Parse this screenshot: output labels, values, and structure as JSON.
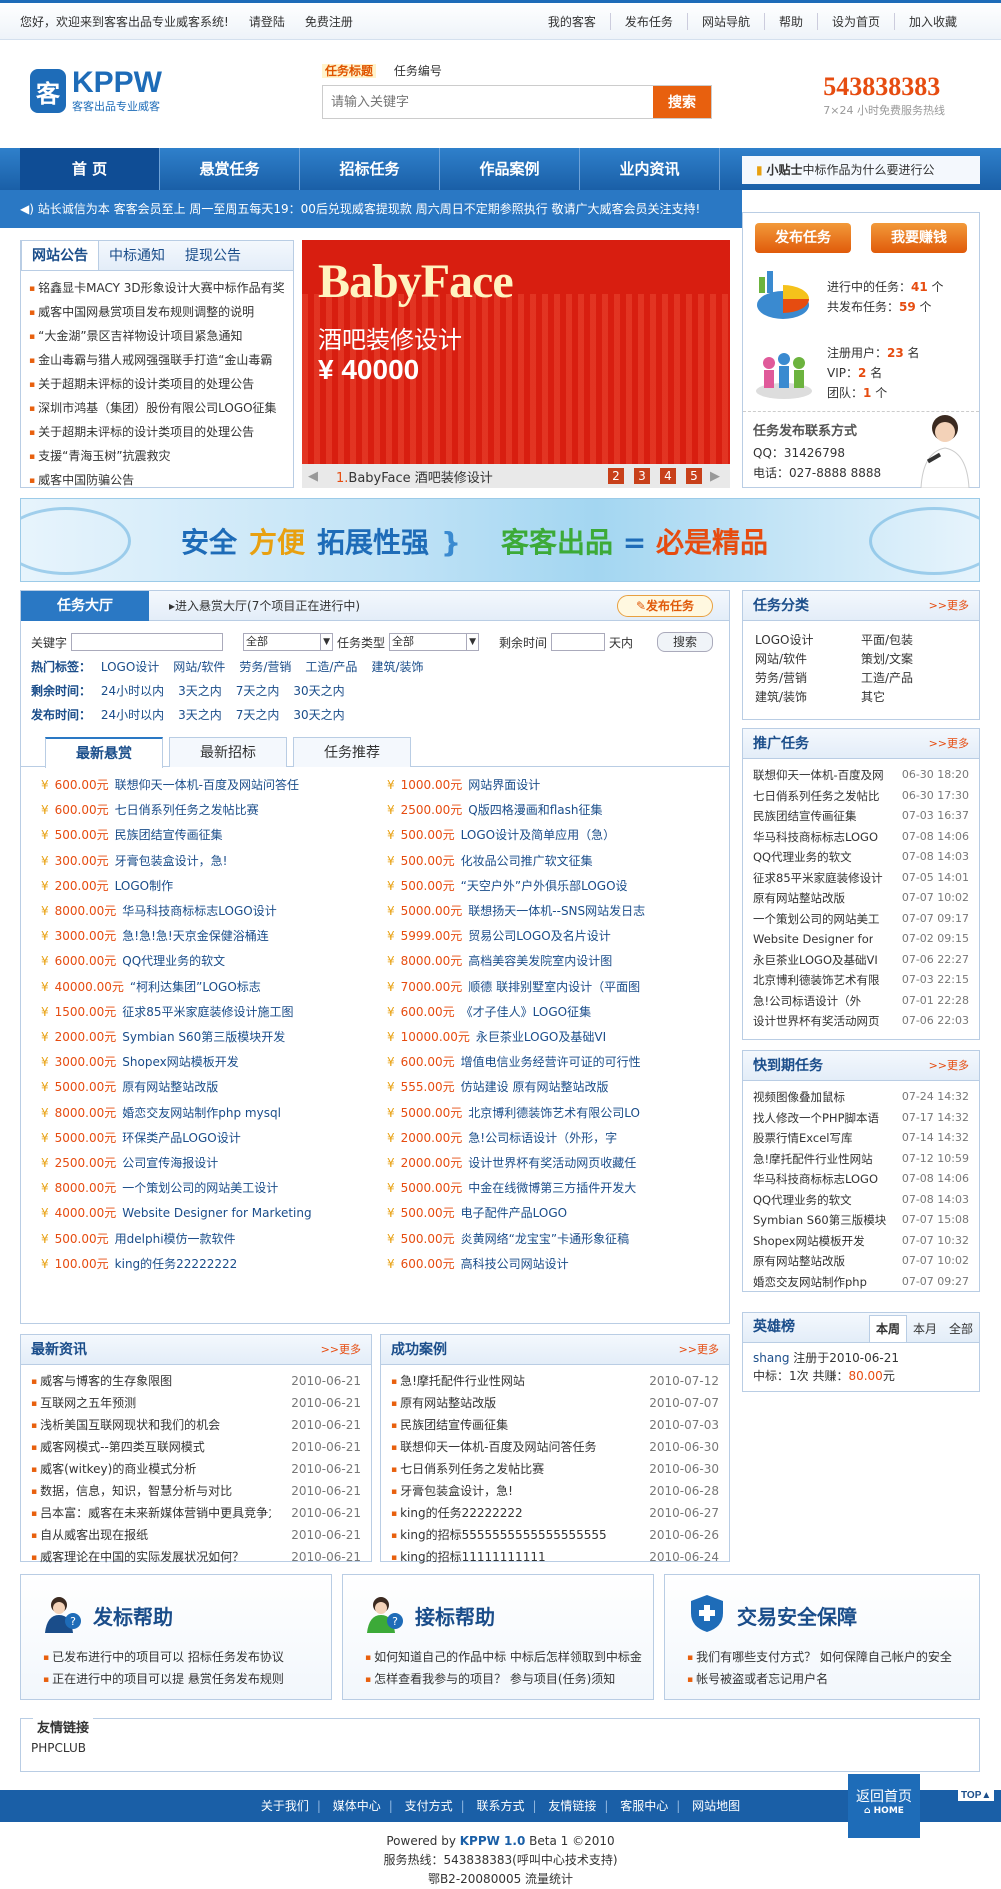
{
  "topbar": {
    "welcome": "您好，欢迎来到客客出品专业威客系统!",
    "login": "请登陆",
    "register": "免费注册",
    "links": [
      "我的客客",
      "发布任务",
      "网站导航",
      "帮助",
      "设为首页",
      "加入收藏"
    ]
  },
  "header": {
    "logo_text": "KPPW",
    "logo_sub": "客客出品专业威客",
    "search_tabs": [
      "任务标题",
      "任务编号"
    ],
    "search_placeholder": "请输入关键字",
    "search_button": "搜索",
    "hotline": "543838383",
    "hotline_note": "7×24 小时免费服务热线"
  },
  "nav": {
    "items": [
      "首  页",
      "悬赏任务",
      "招标任务",
      "作品案例",
      "业内资讯"
    ],
    "tip_label": "小贴士",
    "tip_text": "中标作品为什么要进行公"
  },
  "notice": "站长诚信为本  客客会员至上  周一至周五每天19：00后兑现威客提现款  周六周日不定期参照执行  敬请广大威客会员关注支持!",
  "announcements": {
    "tabs": [
      "网站公告",
      "中标通知",
      "提现公告"
    ],
    "items": [
      "铭鑫显卡MACY 3D形象设计大赛中标作品有奖",
      "威客中国网悬赏项目发布规则调整的说明",
      "“大金湖”景区吉祥物设计项目紧急通知",
      "金山毒霸与猎人戒网强强联手打造“金山毒霸",
      "关于超期未评标的设计类项目的处理公告",
      "深圳市鸿基（集团）股份有限公司LOGO征集",
      "关于超期未评标的设计类项目的处理公告",
      "支援“青海玉树”抗震救灾",
      "威客中国防骗公告"
    ]
  },
  "banner": {
    "title": "BabyFace",
    "subtitle": "酒吧装修设计",
    "price": "¥ 40000",
    "caption_index": "1.",
    "caption": "BabyFace 酒吧装修设计",
    "pages": [
      "2",
      "3",
      "4",
      "5"
    ]
  },
  "side_actions": {
    "publish_button": "发布任务",
    "earn_button": "我要赚钱",
    "ongoing_label": "进行中的任务：",
    "ongoing_value": "41",
    "total_label": "共发布任务：",
    "total_value": "59",
    "unit_tasks": "个",
    "users_label": "注册用户：",
    "users_value": "23",
    "unit_users": "名",
    "vip_label": "VIP：",
    "vip_value": "2",
    "team_label": "团队：",
    "team_value": "1",
    "contact_title": "任务发布联系方式",
    "qq": "QQ：31426798",
    "phone": "电话：027-8888 8888"
  },
  "slogan": {
    "parts": [
      "安全",
      "方便",
      "拓展性强"
    ],
    "brace": "}",
    "brand": "客客出品",
    "equals": "=",
    "result": "必是精品"
  },
  "hall": {
    "tab": "任务大厅",
    "subtitle": "进入悬赏大厅(7个项目正在进行中)",
    "publish": "发布任务",
    "keyword_label": "关键字",
    "select_all": "全部",
    "type_label": "任务类型",
    "type_value": "全部",
    "remain_label": "剩余时间",
    "days_label": "天内",
    "search_button": "搜索",
    "hot_label": "热门标签：",
    "hot_tags": [
      "LOGO设计",
      "网站/软件",
      "劳务/营销",
      "工造/产品",
      "建筑/装饰"
    ],
    "remain_label2": "剩余时间：",
    "remain_opts": [
      "24小时以内",
      "3天之内",
      "7天之内",
      "30天之内"
    ],
    "publish_label": "发布时间：",
    "publish_opts": [
      "24小时以内",
      "3天之内",
      "7天之内",
      "30天之内"
    ],
    "task_tabs": [
      "最新悬赏",
      "最新招标",
      "任务推荐"
    ],
    "currency": "¥",
    "unit": "元",
    "tasks": [
      {
        "amount": "600.00",
        "title": "联想仰天一体机-百度及网站问答任"
      },
      {
        "amount": "1000.00",
        "title": "网站界面设计"
      },
      {
        "amount": "600.00",
        "title": "七日俏系列任务之发帖比赛"
      },
      {
        "amount": "2500.00",
        "title": "Q版四格漫画和flash征集"
      },
      {
        "amount": "500.00",
        "title": "民族团结宣传画征集"
      },
      {
        "amount": "500.00",
        "title": "LOGO设计及简单应用（急）"
      },
      {
        "amount": "300.00",
        "title": "牙膏包装盒设计，急!"
      },
      {
        "amount": "500.00",
        "title": "化妆品公司推广软文征集"
      },
      {
        "amount": "200.00",
        "title": "LOGO制作"
      },
      {
        "amount": "500.00",
        "title": "“天空户外”户外俱乐部LOGO设"
      },
      {
        "amount": "8000.00",
        "title": "华马科技商标标志LOGO设计"
      },
      {
        "amount": "5000.00",
        "title": "联想扬天一体机--SNS网站发日志"
      },
      {
        "amount": "3000.00",
        "title": "急!急!急!天京金保健浴桶连"
      },
      {
        "amount": "5999.00",
        "title": "贸易公司LOGO及名片设计"
      },
      {
        "amount": "6000.00",
        "title": "QQ代理业务的软文"
      },
      {
        "amount": "8000.00",
        "title": "高档美容美发院室内设计图"
      },
      {
        "amount": "40000.00",
        "title": "“柯利达集团”LOGO标志"
      },
      {
        "amount": "7000.00",
        "title": "顺德 联排别墅室内设计（平面图"
      },
      {
        "amount": "1500.00",
        "title": "征求85平米家庭装修设计施工图"
      },
      {
        "amount": "600.00",
        "title": "《才子佳人》LOGO征集"
      },
      {
        "amount": "2000.00",
        "title": "Symbian S60第三版模块开发"
      },
      {
        "amount": "10000.00",
        "title": "永巨茶业LOGO及基础VI"
      },
      {
        "amount": "3000.00",
        "title": "Shopex网站模板开发"
      },
      {
        "amount": "600.00",
        "title": "增值电信业务经营许可证的可行性"
      },
      {
        "amount": "5000.00",
        "title": "原有网站整站改版"
      },
      {
        "amount": "555.00",
        "title": "仿站建设 原有网站整站改版"
      },
      {
        "amount": "8000.00",
        "title": "婚恋交友网站制作php mysql"
      },
      {
        "amount": "5000.00",
        "title": "北京博利德装饰艺术有限公司LO"
      },
      {
        "amount": "5000.00",
        "title": "环保类产品LOGO设计"
      },
      {
        "amount": "2000.00",
        "title": "急!公司标语设计（外形，字"
      },
      {
        "amount": "2500.00",
        "title": "公司宣传海报设计"
      },
      {
        "amount": "2000.00",
        "title": "设计世界杯有奖活动网页收藏任"
      },
      {
        "amount": "8000.00",
        "title": "一个策划公司的网站美工设计"
      },
      {
        "amount": "5000.00",
        "title": "中金在线微博第三方插件开发大"
      },
      {
        "amount": "4000.00",
        "title": "Website Designer for Marketing"
      },
      {
        "amount": "500.00",
        "title": "电子配件产品LOGO"
      },
      {
        "amount": "500.00",
        "title": "用delphi模仿一款软件"
      },
      {
        "amount": "500.00",
        "title": "炎黄网络“龙宝宝”卡通形象征稿"
      },
      {
        "amount": "100.00",
        "title": "king的任务22222222"
      },
      {
        "amount": "600.00",
        "title": "高科技公司网站设计"
      }
    ]
  },
  "categories": {
    "title": "任务分类",
    "more": ">>更多",
    "items": [
      "LOGO设计",
      "平面/包装",
      "网站/软件",
      "策划/文案",
      "劳务/营销",
      "工造/产品",
      "建筑/装饰",
      "其它"
    ]
  },
  "promo": {
    "title": "推广任务",
    "more": ">>更多",
    "items": [
      {
        "name": "联想仰天一体机-百度及网",
        "date": "06-30 18:20"
      },
      {
        "name": "七日俏系列任务之发帖比",
        "date": "06-30 17:30"
      },
      {
        "name": "民族团结宣传画征集",
        "date": "07-03 16:37"
      },
      {
        "name": "华马科技商标标志LOGO",
        "date": "07-08 14:06"
      },
      {
        "name": "QQ代理业务的软文",
        "date": "07-08 14:03"
      },
      {
        "name": "征求85平米家庭装修设计",
        "date": "07-05 14:01"
      },
      {
        "name": "原有网站整站改版",
        "date": "07-07 10:02"
      },
      {
        "name": "一个策划公司的网站美工",
        "date": "07-07 09:17"
      },
      {
        "name": "Website Designer for",
        "date": "07-02 09:15"
      },
      {
        "name": "永巨茶业LOGO及基础VI",
        "date": "07-06 22:27"
      },
      {
        "name": "北京博利德装饰艺术有限",
        "date": "07-03 22:15"
      },
      {
        "name": "急!公司标语设计（外",
        "date": "07-01 22:28"
      },
      {
        "name": "设计世界杯有奖活动网页",
        "date": "07-06 22:03"
      }
    ]
  },
  "soon": {
    "title": "快到期任务",
    "more": ">>更多",
    "items": [
      {
        "name": "视频图像叠加鼠标",
        "date": "07-24 14:32"
      },
      {
        "name": "找人修改一个PHP脚本语",
        "date": "07-17 14:32"
      },
      {
        "name": "股票行情Excel写库",
        "date": "07-14 14:32"
      },
      {
        "name": "急!摩托配件行业性网站",
        "date": "07-12 10:59"
      },
      {
        "name": "华马科技商标标志LOGO",
        "date": "07-08 14:06"
      },
      {
        "name": "QQ代理业务的软文",
        "date": "07-08 14:03"
      },
      {
        "name": "Symbian S60第三版模块",
        "date": "07-07 15:08"
      },
      {
        "name": "Shopex网站模板开发",
        "date": "07-07 10:32"
      },
      {
        "name": "原有网站整站改版",
        "date": "07-07 10:02"
      },
      {
        "name": "婚恋交友网站制作php",
        "date": "07-07 09:27"
      }
    ]
  },
  "hero": {
    "title": "英雄榜",
    "tabs": [
      "本周",
      "本月",
      "全部"
    ],
    "user": "shang",
    "reg_text": "注册于2010-06-21",
    "stats_label": "中标：1次  共赚：",
    "earned": "80.00",
    "earned_unit": "元"
  },
  "news": {
    "title": "最新资讯",
    "more": ">>更多",
    "items": [
      {
        "name": "威客与博客的生存象限图",
        "date": "2010-06-21"
      },
      {
        "name": "互联网之五年预测",
        "date": "2010-06-21"
      },
      {
        "name": "浅析美国互联网现状和我们的机会",
        "date": "2010-06-21"
      },
      {
        "name": "威客网模式--第四类互联网模式",
        "date": "2010-06-21"
      },
      {
        "name": "威客(witkey)的商业模式分析",
        "date": "2010-06-21"
      },
      {
        "name": "数据，信息，知识，智慧分析与对比",
        "date": "2010-06-21"
      },
      {
        "name": "吕本富：威客在未来新媒体营销中更具竞争力",
        "date": "2010-06-21"
      },
      {
        "name": "自从威客出现在报纸",
        "date": "2010-06-21"
      },
      {
        "name": "威客理论在中国的实际发展状况如何？",
        "date": "2010-06-21"
      }
    ]
  },
  "cases": {
    "title": "成功案例",
    "more": ">>更多",
    "items": [
      {
        "name": "急!摩托配件行业性网站",
        "date": "2010-07-12"
      },
      {
        "name": "原有网站整站改版",
        "date": "2010-07-07"
      },
      {
        "name": "民族团结宣传画征集",
        "date": "2010-07-03"
      },
      {
        "name": "联想仰天一体机-百度及网站问答任务",
        "date": "2010-06-30"
      },
      {
        "name": "七日俏系列任务之发帖比赛",
        "date": "2010-06-30"
      },
      {
        "name": "牙膏包装盒设计，急!",
        "date": "2010-06-28"
      },
      {
        "name": "king的任务22222222",
        "date": "2010-06-27"
      },
      {
        "name": "king的招标5555555555555555555",
        "date": "2010-06-26"
      },
      {
        "name": "king的招标11111111111",
        "date": "2010-06-24"
      }
    ]
  },
  "help": {
    "publish": {
      "title": "发标帮助",
      "lines": [
        "已发布进行中的项目可以 招标任务发布协议",
        "正在进行中的项目可以提 悬赏任务发布规则"
      ]
    },
    "bid": {
      "title": "接标帮助",
      "lines": [
        "如何知道自己的作品中标 中标后怎样领取到中标金",
        "怎样查看我参与的项目？ 参与项目(任务)须知"
      ]
    },
    "safe": {
      "title": "交易安全保障",
      "lines": [
        "我们有哪些支付方式？ 如何保障自己帐户的安全",
        "帐号被盗或者忘记用户名"
      ]
    }
  },
  "friend_links": {
    "title": "友情链接",
    "items": [
      "PHPCLUB"
    ]
  },
  "footer": {
    "links": [
      "关于我们",
      "媒体中心",
      "支付方式",
      "联系方式",
      "友情链接",
      "客服中心",
      "网站地图"
    ],
    "back_top": "返回首页",
    "back_top_sub": "HOME",
    "top": "TOP",
    "powered_prefix": "Powered by ",
    "powered_brand": "KPPW 1.0",
    "powered_suffix": " Beta 1 ©2010",
    "hotline": "服务热线：543838383(呼叫中心技术支持)",
    "icp": "鄂B2-20080005  流量统计"
  },
  "colors": {
    "brand": "#1e6cb8",
    "accent": "#e64c10",
    "nav": "#1a5fa7"
  }
}
